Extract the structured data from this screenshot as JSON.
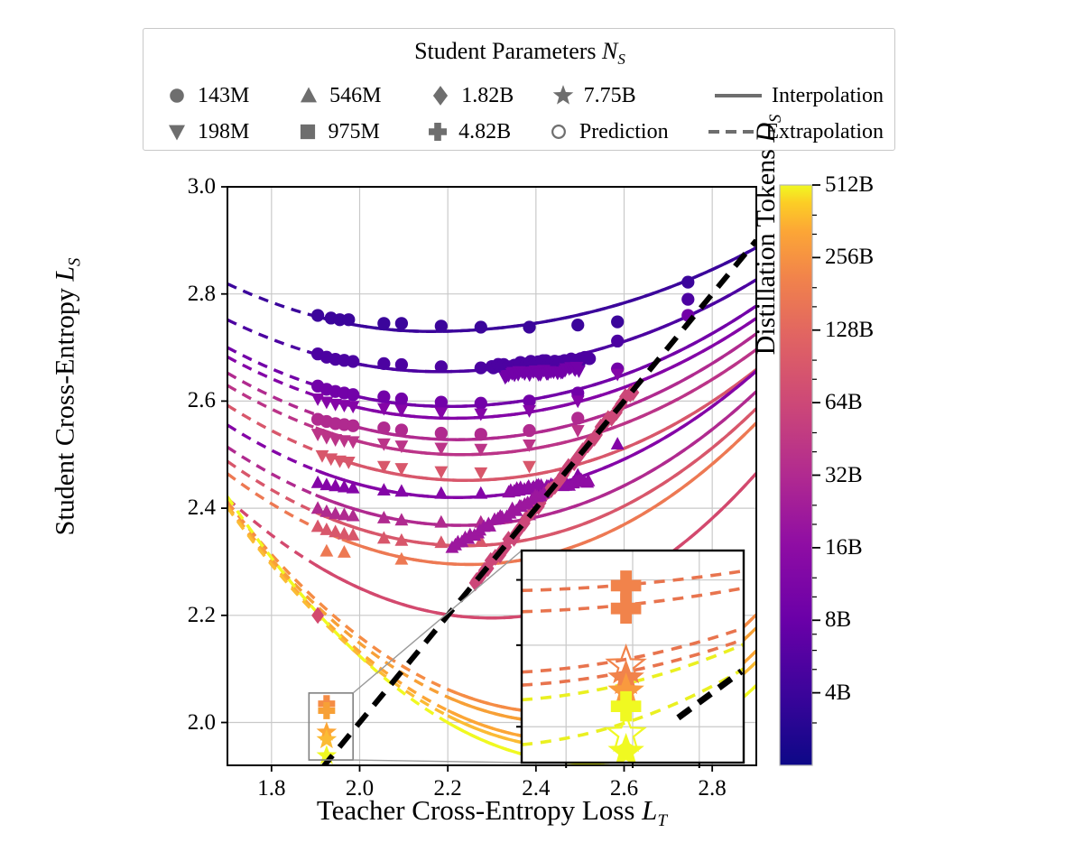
{
  "figure": {
    "xlabel": "Teacher Cross-Entropy Loss L_T",
    "ylabel": "Student Cross-Entropy L_S",
    "colorbar_label": "Distillation Tokens D_S"
  },
  "legend": {
    "title": "Student Parameters N_S",
    "title_main": "Student Parameters ",
    "title_sym": "N",
    "title_sub": "S",
    "entries": [
      {
        "marker": "circle",
        "label": "143M"
      },
      {
        "marker": "triangle-up",
        "label": "546M"
      },
      {
        "marker": "diamond",
        "label": "1.82B"
      },
      {
        "marker": "star",
        "label": "7.75B"
      },
      {
        "marker": "solid-line",
        "label": "Interpolation"
      },
      {
        "marker": "triangle-down",
        "label": "198M"
      },
      {
        "marker": "square",
        "label": "975M"
      },
      {
        "marker": "plus",
        "label": "4.82B"
      },
      {
        "marker": "open-circle",
        "label": "Prediction"
      },
      {
        "marker": "dashed-line",
        "label": "Extrapolation"
      }
    ],
    "marker_color": "#6e6e6e"
  },
  "chart_data": {
    "type": "scatter",
    "title": "",
    "xlabel": "Teacher Cross-Entropy Loss L_T",
    "ylabel": "Student Cross-Entropy L_S",
    "xlim": [
      1.7,
      2.9
    ],
    "ylim": [
      1.92,
      3.0
    ],
    "xticks": [
      1.8,
      2.0,
      2.2,
      2.4,
      2.6,
      2.8
    ],
    "xticklabels": [
      "1.8",
      "2.0",
      "2.2",
      "2.4",
      "2.6",
      "2.8"
    ],
    "yticks": [
      2.0,
      2.2,
      2.4,
      2.6,
      2.8,
      3.0
    ],
    "yticklabels": [
      "2.0",
      "2.2",
      "2.4",
      "2.6",
      "2.8",
      "3.0"
    ],
    "grid": true,
    "legend_position": "above-axes",
    "colorbar": {
      "label": "Distillation Tokens D_S",
      "scale": "log2",
      "vmin": 2,
      "vmax": 512,
      "ticks": [
        4,
        8,
        16,
        32,
        64,
        128,
        256,
        512
      ],
      "ticklabels": [
        "4B",
        "8B",
        "16B",
        "32B",
        "64B",
        "128B",
        "256B",
        "512B"
      ],
      "colormap": "plasma",
      "stops": [
        {
          "pos": 0.0,
          "color": "#0d0887"
        },
        {
          "pos": 0.12,
          "color": "#3a049a"
        },
        {
          "pos": 0.25,
          "color": "#6a00a8"
        },
        {
          "pos": 0.38,
          "color": "#8f0da4"
        },
        {
          "pos": 0.5,
          "color": "#b12a90"
        },
        {
          "pos": 0.62,
          "color": "#cc4778"
        },
        {
          "pos": 0.74,
          "color": "#e16462"
        },
        {
          "pos": 0.84,
          "color": "#f1834b"
        },
        {
          "pos": 0.92,
          "color": "#fca636"
        },
        {
          "pos": 0.97,
          "color": "#fcce25"
        },
        {
          "pos": 1.0,
          "color": "#f0f921"
        }
      ]
    },
    "reference_line": {
      "name": "teacher-equals-student",
      "style": "dashed",
      "color": "#000000",
      "width": 6,
      "x": [
        1.915,
        2.9
      ],
      "y": [
        1.915,
        2.9
      ]
    },
    "series": [
      {
        "name": "143M / 4B",
        "marker": "circle",
        "tokens": 4,
        "color": "#3b059b",
        "interp_x": [
          1.9,
          2.9
        ],
        "fit": {
          "a": 0.55,
          "x0": 2.16,
          "ymin": 2.73,
          "curv": 0.42,
          "asym": 0.62
        },
        "points_x": [
          1.905,
          1.935,
          1.955,
          1.975,
          2.055,
          2.095,
          2.185,
          2.275,
          2.385,
          2.495,
          2.585,
          2.745
        ],
        "points_y": [
          2.76,
          2.755,
          2.752,
          2.752,
          2.745,
          2.745,
          2.74,
          2.738,
          2.738,
          2.742,
          2.748,
          2.822
        ]
      },
      {
        "name": "198M / 4B",
        "marker": "circle",
        "tokens": 5,
        "color": "#4c02a1",
        "interp_x": [
          1.9,
          2.9
        ],
        "fit": {
          "a": 0.55,
          "x0": 2.18,
          "ymin": 2.655,
          "curv": 0.42,
          "asym": 0.72
        },
        "points_x": [
          1.905,
          1.925,
          1.945,
          1.965,
          1.985,
          2.055,
          2.095,
          2.185,
          2.275,
          2.385,
          2.495,
          2.585,
          2.745
        ],
        "points_y": [
          2.688,
          2.682,
          2.678,
          2.676,
          2.674,
          2.67,
          2.668,
          2.664,
          2.662,
          2.664,
          2.675,
          2.712,
          2.79
        ]
      },
      {
        "name": "143M / 8B",
        "marker": "circle",
        "tokens": 8,
        "color": "#7201a8",
        "interp_x": [
          1.9,
          2.9
        ],
        "fit": {
          "a": 0.55,
          "x0": 2.2,
          "ymin": 2.59,
          "curv": 0.44,
          "asym": 0.8
        },
        "points_x": [
          1.905,
          1.925,
          1.945,
          1.965,
          1.985,
          2.055,
          2.095,
          2.185,
          2.275,
          2.385,
          2.495,
          2.585,
          2.745
        ],
        "points_y": [
          2.628,
          2.622,
          2.618,
          2.615,
          2.612,
          2.608,
          2.604,
          2.598,
          2.596,
          2.6,
          2.615,
          2.66,
          2.76
        ]
      },
      {
        "name": "198M / 8B",
        "marker": "triangle-down",
        "tokens": 9,
        "color": "#8405a7",
        "interp_x": [
          1.9,
          2.9
        ],
        "fit": {
          "a": 0.55,
          "x0": 2.21,
          "ymin": 2.568,
          "curv": 0.44,
          "asym": 0.82
        },
        "points_x": [
          1.905,
          1.925,
          1.945,
          1.965,
          1.985,
          2.055,
          2.095,
          2.185,
          2.275,
          2.385,
          2.495,
          2.585
        ],
        "points_y": [
          2.604,
          2.598,
          2.594,
          2.592,
          2.59,
          2.586,
          2.583,
          2.578,
          2.576,
          2.582,
          2.6,
          2.65
        ]
      },
      {
        "name": "143M / 16B",
        "marker": "circle",
        "tokens": 16,
        "color": "#b02a8f",
        "interp_x": [
          1.9,
          2.9
        ],
        "fit": {
          "a": 0.55,
          "x0": 2.22,
          "ymin": 2.528,
          "curv": 0.46,
          "asym": 0.86
        },
        "points_x": [
          1.905,
          1.925,
          1.945,
          1.965,
          1.985,
          2.055,
          2.095,
          2.185,
          2.275,
          2.385,
          2.495
        ],
        "points_y": [
          2.566,
          2.562,
          2.558,
          2.556,
          2.554,
          2.55,
          2.546,
          2.54,
          2.538,
          2.545,
          2.568
        ]
      },
      {
        "name": "198M / 16B",
        "marker": "triangle-down",
        "tokens": 18,
        "color": "#bb3488",
        "interp_x": [
          1.9,
          2.9
        ],
        "fit": {
          "a": 0.55,
          "x0": 2.23,
          "ymin": 2.5,
          "curv": 0.46,
          "asym": 0.88
        },
        "points_x": [
          1.905,
          1.925,
          1.945,
          1.965,
          1.985,
          2.055,
          2.095,
          2.185,
          2.275,
          2.385,
          2.495
        ],
        "points_y": [
          2.538,
          2.532,
          2.528,
          2.526,
          2.524,
          2.52,
          2.516,
          2.512,
          2.51,
          2.518,
          2.545
        ]
      },
      {
        "name": "198M / 32B",
        "marker": "triangle-down",
        "tokens": 32,
        "color": "#d8576b",
        "interp_x": [
          1.92,
          2.9
        ],
        "fit": {
          "a": 0.55,
          "x0": 2.24,
          "ymin": 2.452,
          "curv": 0.48,
          "asym": 0.92
        },
        "points_x": [
          1.915,
          1.935,
          1.955,
          1.975,
          2.055,
          2.095,
          2.185,
          2.275,
          2.385
        ],
        "points_y": [
          2.498,
          2.492,
          2.488,
          2.486,
          2.478,
          2.474,
          2.468,
          2.466,
          2.478
        ]
      },
      {
        "name": "546M / 8B",
        "marker": "triangle-up",
        "tokens": 8,
        "color": "#8405a7",
        "interp_x": [
          1.9,
          2.9
        ],
        "fit": {
          "a": 0.55,
          "x0": 2.22,
          "ymin": 2.42,
          "curv": 0.5,
          "asym": 0.95
        },
        "points_x": [
          1.905,
          1.925,
          1.945,
          1.965,
          1.985,
          2.055,
          2.095,
          2.185,
          2.275,
          2.385,
          2.495,
          2.585
        ],
        "points_y": [
          2.448,
          2.444,
          2.442,
          2.44,
          2.438,
          2.434,
          2.432,
          2.428,
          2.428,
          2.436,
          2.462,
          2.52
        ]
      },
      {
        "name": "546M / 16B",
        "marker": "triangle-up",
        "tokens": 16,
        "color": "#b02a8f",
        "interp_x": [
          1.9,
          2.9
        ],
        "fit": {
          "a": 0.55,
          "x0": 2.23,
          "ymin": 2.368,
          "curv": 0.52,
          "asym": 1.0
        },
        "points_x": [
          1.905,
          1.925,
          1.945,
          1.965,
          1.985,
          2.055,
          2.095,
          2.185,
          2.275,
          2.385
        ],
        "points_y": [
          2.4,
          2.394,
          2.39,
          2.388,
          2.386,
          2.382,
          2.378,
          2.374,
          2.374,
          2.388
        ]
      },
      {
        "name": "546M / 32B",
        "marker": "triangle-up",
        "tokens": 32,
        "color": "#d8576b",
        "interp_x": [
          1.9,
          2.9
        ],
        "fit": {
          "a": 0.55,
          "x0": 2.24,
          "ymin": 2.33,
          "curv": 0.54,
          "asym": 1.02
        },
        "points_x": [
          1.905,
          1.925,
          1.945,
          1.965,
          1.985,
          2.055,
          2.095,
          2.185,
          2.275
        ],
        "points_y": [
          2.366,
          2.36,
          2.356,
          2.352,
          2.35,
          2.344,
          2.34,
          2.336,
          2.338
        ]
      },
      {
        "name": "546M / 64B",
        "marker": "triangle-up",
        "tokens": 64,
        "color": "#ed7953",
        "interp_x": [
          1.96,
          2.9
        ],
        "fit": {
          "a": 0.55,
          "x0": 2.25,
          "ymin": 2.295,
          "curv": 0.56,
          "asym": 1.05
        },
        "points_x": [
          1.925,
          1.965,
          2.095
        ],
        "points_y": [
          2.32,
          2.318,
          2.305
        ]
      },
      {
        "name": "1.82B / 32B",
        "marker": "diamond",
        "tokens": 30,
        "color": "#d3496e",
        "interp_x": [
          1.9,
          2.9
        ],
        "fit": {
          "a": 0.55,
          "x0": 2.3,
          "ymin": 2.195,
          "curv": 0.62,
          "asym": 1.15
        },
        "points_x": [
          1.905
        ],
        "points_y": [
          2.2
        ]
      },
      {
        "name": "4.82B / 128B",
        "marker": "plus",
        "tokens": 128,
        "color": "#f58c45",
        "interp_x": [
          2.2,
          2.9
        ],
        "fit": {
          "a": 0.55,
          "x0": 2.45,
          "ymin": 2.018,
          "curv": 0.7,
          "asym": 1.25
        },
        "points_x": [
          1.925
        ],
        "points_y": [
          2.035
        ]
      },
      {
        "name": "4.82B / 256B",
        "marker": "plus",
        "tokens": 200,
        "color": "#f7a036",
        "interp_x": [
          2.2,
          2.9
        ],
        "fit": {
          "a": 0.55,
          "x0": 2.46,
          "ymin": 2.0,
          "curv": 0.7,
          "asym": 1.26
        },
        "points_x": [
          1.925
        ],
        "points_y": [
          2.022
        ]
      },
      {
        "name": "7.75B / 256B",
        "marker": "star",
        "tokens": 256,
        "color": "#fca636",
        "interp_x": [
          2.2,
          2.9
        ],
        "fit": {
          "a": 0.55,
          "x0": 2.48,
          "ymin": 1.966,
          "curv": 0.72,
          "asym": 1.28
        },
        "points_x": [
          1.925
        ],
        "points_y": [
          1.982
        ]
      },
      {
        "name": "7.75B / 384B",
        "marker": "star",
        "tokens": 384,
        "color": "#fbbb34",
        "interp_x": [
          2.2,
          2.9
        ],
        "fit": {
          "a": 0.55,
          "x0": 2.49,
          "ymin": 1.952,
          "curv": 0.72,
          "asym": 1.29
        },
        "points_x": [
          1.925
        ],
        "points_y": [
          1.968
        ]
      },
      {
        "name": "7.75B / 512B",
        "marker": "star",
        "tokens": 512,
        "color": "#f0f921",
        "interp_x": [
          2.2,
          2.9
        ],
        "fit": {
          "a": 0.55,
          "x0": 2.52,
          "ymin": 1.924,
          "curv": 0.74,
          "asym": 1.32
        },
        "points_x": [
          1.925
        ],
        "points_y": [
          1.938
        ]
      }
    ],
    "dense_clusters": [
      {
        "marker": "circle",
        "color": "#4c02a1",
        "x0": 2.3,
        "x1": 2.52,
        "y0": 2.664,
        "y1": 2.678,
        "n": 40
      },
      {
        "marker": "triangle-down",
        "color": "#7201a8",
        "x0": 2.33,
        "x1": 2.5,
        "y0": 2.648,
        "y1": 2.66,
        "n": 36
      },
      {
        "marker": "triangle-up",
        "color": "#8f0da4",
        "x0": 2.34,
        "x1": 2.52,
        "y0": 2.432,
        "y1": 2.452,
        "n": 34
      },
      {
        "marker": "diamond",
        "color": "#cc4778",
        "x0": 2.26,
        "x1": 2.62,
        "y0": 2.26,
        "y1": 2.62,
        "n": 46
      },
      {
        "marker": "triangle-up",
        "color": "#9c179e",
        "x0": 2.21,
        "x1": 2.42,
        "y0": 2.33,
        "y1": 2.43,
        "n": 30
      }
    ],
    "zoom_rect": {
      "x0": 1.885,
      "x1": 1.985,
      "y0": 1.93,
      "y1": 2.055
    },
    "inset": {
      "xlim": [
        1.885,
        1.985
      ],
      "ylim": [
        1.928,
        2.058
      ],
      "series_notes": "plus markers at ~2.035 and ~2.022; stars at ~1.982, ~1.968 and ~1.938; open star predictions",
      "markers": [
        {
          "marker": "plus",
          "color": "#f1834b",
          "x": 1.932,
          "y": 2.0365,
          "filled": true
        },
        {
          "marker": "plus",
          "color": "#f1834b",
          "x": 1.932,
          "y": 2.0225,
          "filled": true
        },
        {
          "marker": "star",
          "color": "#f1834b",
          "x": 1.932,
          "y": 1.9875,
          "filled": false
        },
        {
          "marker": "star",
          "color": "#f1834b",
          "x": 1.932,
          "y": 1.9795,
          "filled": true
        },
        {
          "marker": "star",
          "color": "#f99a3e",
          "x": 1.932,
          "y": 1.9715,
          "filled": true
        },
        {
          "marker": "plus",
          "color": "#f0f921",
          "x": 1.932,
          "y": 1.9625,
          "filled": true
        },
        {
          "marker": "star",
          "color": "#f0f921",
          "x": 1.932,
          "y": 1.9455,
          "filled": false
        },
        {
          "marker": "star",
          "color": "#f0f921",
          "x": 1.932,
          "y": 1.9345,
          "filled": true
        }
      ],
      "curves": [
        {
          "color": "#e8744e",
          "y_at_left": 2.0335,
          "y_at_right": 2.0455
        },
        {
          "color": "#e8744e",
          "y_at_left": 2.0205,
          "y_at_right": 2.035
        },
        {
          "color": "#e8744e",
          "y_at_left": 1.9835,
          "y_at_right": 2.0105
        },
        {
          "color": "#e8744e",
          "y_at_left": 1.9755,
          "y_at_right": 2.0035
        },
        {
          "color": "#eaf021",
          "y_at_left": 1.9665,
          "y_at_right": 2.0005
        },
        {
          "color": "#eaf021",
          "y_at_left": 1.939,
          "y_at_right": 1.9855
        }
      ],
      "reference_line": {
        "color": "#000000",
        "x0": 1.9555,
        "x1": 1.984
      }
    }
  }
}
